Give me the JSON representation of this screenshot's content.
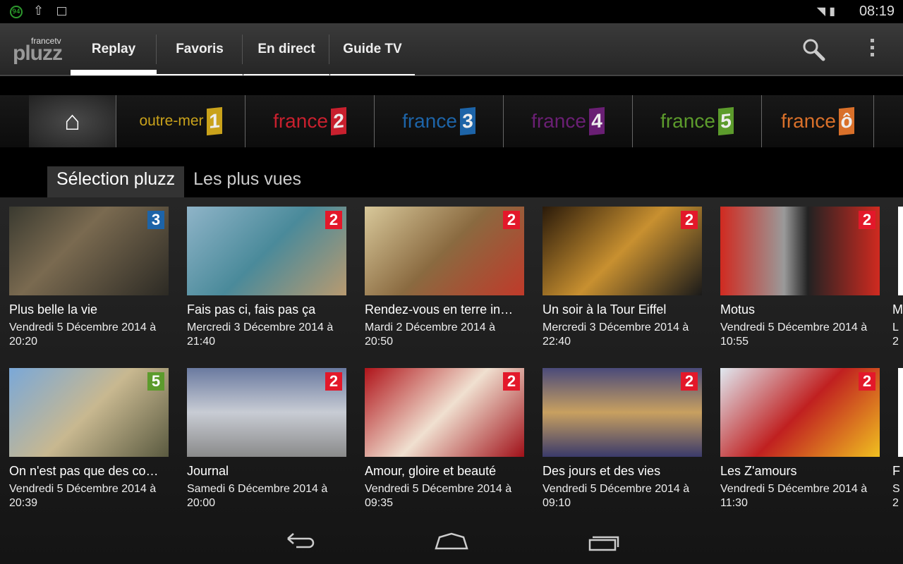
{
  "status_bar": {
    "notification_badge": "94",
    "time": "08:19",
    "icons": [
      "upload-icon",
      "image-icon",
      "wifi-icon",
      "battery-icon"
    ]
  },
  "app": {
    "logo_top": "francetv",
    "logo_main": "pluzz"
  },
  "tabs": [
    {
      "label": "Replay",
      "active": true
    },
    {
      "label": "Favoris"
    },
    {
      "label": "En direct"
    },
    {
      "label": "Guide TV"
    }
  ],
  "actions": [
    "search-icon",
    "overflow-menu-icon"
  ],
  "channels": [
    {
      "name": "home",
      "icon": "home-icon"
    },
    {
      "name": "outre-mer",
      "num": "1",
      "color": "#c9a21b"
    },
    {
      "name": "france",
      "num": "2",
      "color": "#c8202e"
    },
    {
      "name": "france",
      "num": "3",
      "color": "#1d64a8"
    },
    {
      "name": "france",
      "num": "4",
      "color": "#6a1f74"
    },
    {
      "name": "france",
      "num": "5",
      "color": "#5c9b2c"
    },
    {
      "name": "france",
      "num": "ô",
      "color": "#d9702a"
    }
  ],
  "subtabs": [
    {
      "label": "Sélection pluzz",
      "active": true
    },
    {
      "label": "Les plus vues"
    }
  ],
  "programs": [
    {
      "title": "Plus belle la vie",
      "date": "Vendredi 5 Décembre 2014 à",
      "time": "20:20",
      "channel": "3"
    },
    {
      "title": "Fais pas ci, fais pas ça",
      "date": "Mercredi 3 Décembre 2014 à",
      "time": "21:40",
      "channel": "2"
    },
    {
      "title": "Rendez-vous en terre in…",
      "date": "Mardi 2 Décembre 2014 à",
      "time": "20:50",
      "channel": "2"
    },
    {
      "title": "Un soir à la Tour Eiffel",
      "date": "Mercredi 3 Décembre 2014 à",
      "time": "22:40",
      "channel": "2"
    },
    {
      "title": "Motus",
      "date": "Vendredi 5 Décembre 2014 à",
      "time": "10:55",
      "channel": "2"
    },
    {
      "title": "M",
      "date": "L",
      "time": "2",
      "channel": ""
    },
    {
      "title": "On n'est pas que des co…",
      "date": "Vendredi 5 Décembre 2014 à",
      "time": "20:39",
      "channel": "5"
    },
    {
      "title": "Journal",
      "date": "Samedi 6 Décembre 2014 à",
      "time": "20:00",
      "channel": "2"
    },
    {
      "title": "Amour, gloire et beauté",
      "date": "Vendredi 5 Décembre 2014 à",
      "time": "09:35",
      "channel": "2"
    },
    {
      "title": "Des jours et des vies",
      "date": "Vendredi 5 Décembre 2014 à",
      "time": "09:10",
      "channel": "2"
    },
    {
      "title": "Les Z'amours",
      "date": "Vendredi 5 Décembre 2014 à",
      "time": "11:30",
      "channel": "2"
    },
    {
      "title": "F",
      "date": "S",
      "time": "2",
      "channel": ""
    }
  ],
  "nav_bar": [
    "back-icon",
    "home-icon",
    "recent-apps-icon"
  ]
}
